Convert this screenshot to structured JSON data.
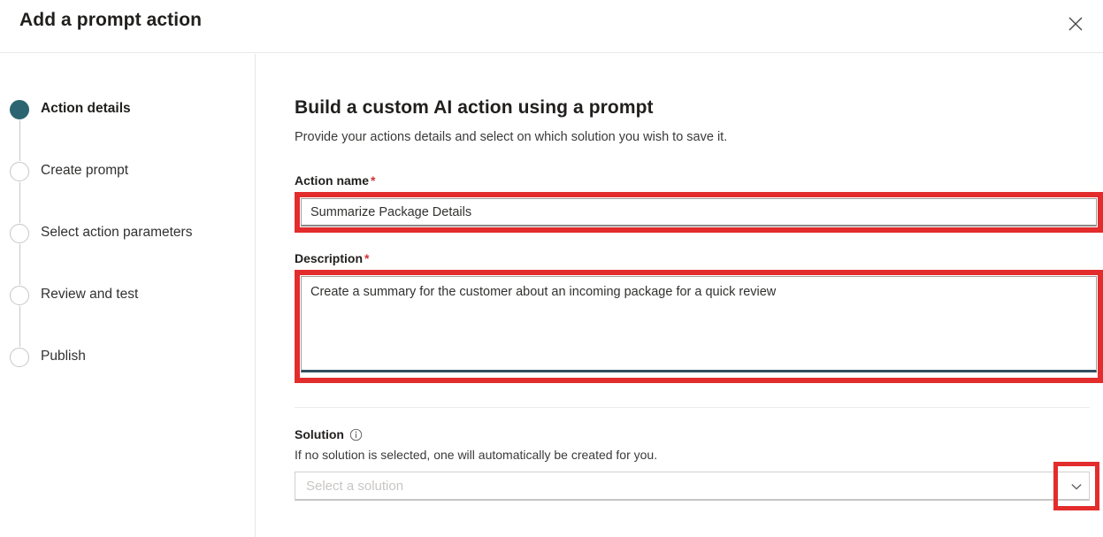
{
  "header": {
    "title": "Add a prompt action",
    "close_label": "Close"
  },
  "wizard": {
    "steps": [
      {
        "label": "Action details",
        "state": "active"
      },
      {
        "label": "Create prompt",
        "state": "inactive"
      },
      {
        "label": "Select action parameters",
        "state": "inactive"
      },
      {
        "label": "Review and test",
        "state": "inactive"
      },
      {
        "label": "Publish",
        "state": "inactive"
      }
    ]
  },
  "main": {
    "heading": "Build a custom AI action using a prompt",
    "subtext": "Provide your actions details and select on which solution you wish to save it.",
    "action_name": {
      "label": "Action name",
      "required_marker": "*",
      "value": "Summarize Package Details",
      "placeholder": ""
    },
    "description": {
      "label": "Description",
      "required_marker": "*",
      "value": "Create a summary for the customer about an incoming package for a quick review",
      "placeholder": ""
    },
    "solution": {
      "label": "Solution",
      "info_icon": "info-circle-icon",
      "help_text": "If no solution is selected, one will automatically be created for you.",
      "placeholder": "Select a solution",
      "value": "",
      "chevron_icon": "chevron-down-icon"
    }
  },
  "colors": {
    "accent": "#2d6472",
    "highlight": "#e32c2c",
    "required": "#d13438",
    "focus_underline": "#2f4f5f"
  }
}
